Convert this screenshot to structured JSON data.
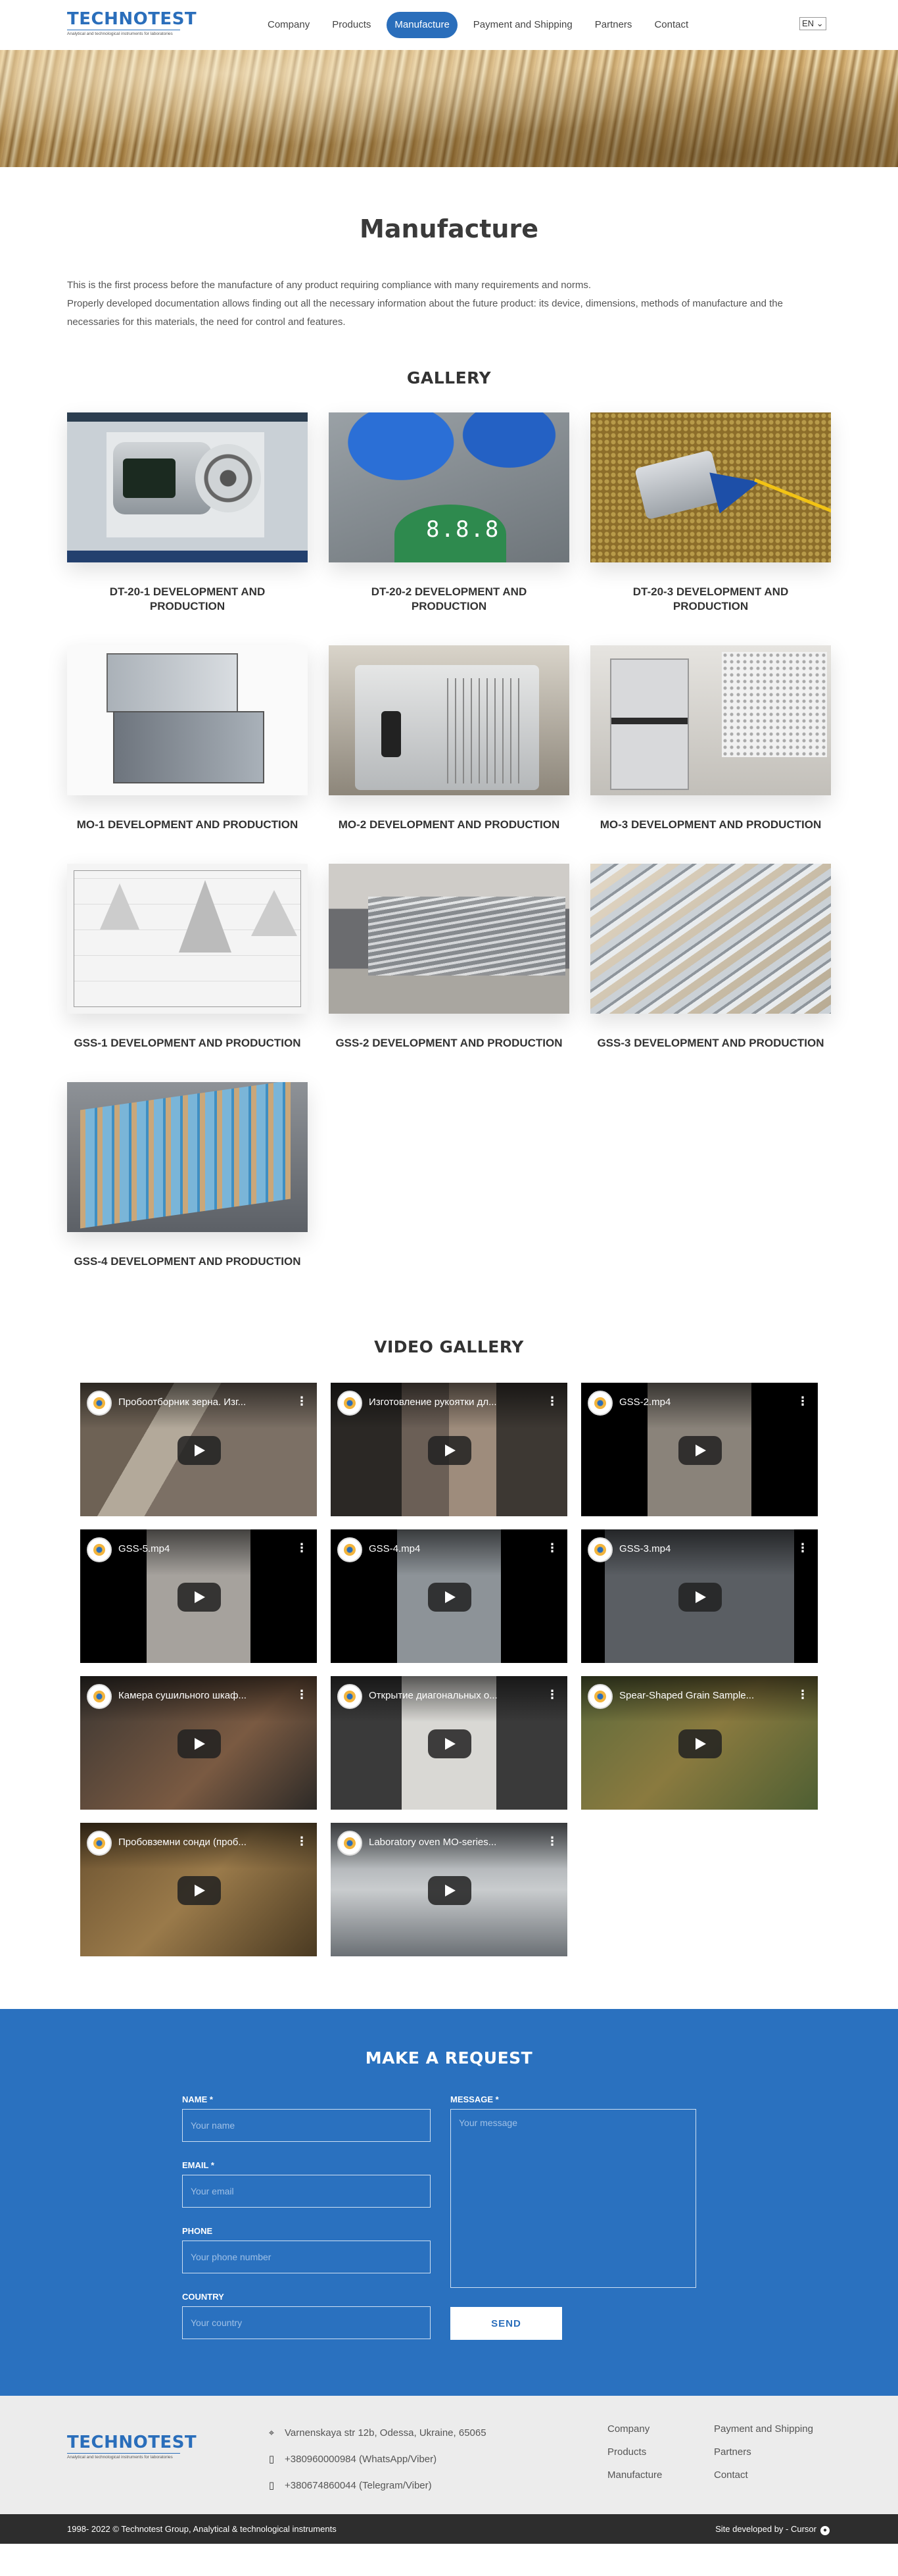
{
  "header": {
    "logo_main": "TECHNOTEST",
    "logo_sub": "Analytical and technological instruments for laboratories",
    "nav": [
      {
        "label": "Company"
      },
      {
        "label": "Products"
      },
      {
        "label": "Manufacture",
        "active": true
      },
      {
        "label": "Payment and Shipping"
      },
      {
        "label": "Partners"
      },
      {
        "label": "Contact"
      }
    ],
    "lang": "EN"
  },
  "main": {
    "title": "Manufacture",
    "intro_line1": "This is the first process before the manufacture of any product requiring compliance with many requirements and norms.",
    "intro_line2": "Properly developed documentation allows finding out all the necessary information about the future product: its device, dimensions, methods of manufacture and the necessaries for this materials, the need for control and features."
  },
  "gallery": {
    "title": "GALLERY",
    "items": [
      {
        "caption": "DT-20-1 DEVELOPMENT AND PRODUCTION",
        "image": "img-dt1"
      },
      {
        "caption": "DT-20-2 DEVELOPMENT AND PRODUCTION",
        "image": "img-dt2"
      },
      {
        "caption": "DT-20-3 DEVELOPMENT AND PRODUCTION",
        "image": "img-dt3"
      },
      {
        "caption": "MO-1 DEVELOPMENT AND PRODUCTION",
        "image": "img-mo1"
      },
      {
        "caption": "MO-2 DEVELOPMENT AND PRODUCTION",
        "image": "img-mo2"
      },
      {
        "caption": "MO-3 DEVELOPMENT AND PRODUCTION",
        "image": "img-mo3"
      },
      {
        "caption": "GSS-1 DEVELOPMENT AND PRODUCTION",
        "image": "img-gss1"
      },
      {
        "caption": "GSS-2 DEVELOPMENT AND PRODUCTION",
        "image": "img-gss2"
      },
      {
        "caption": "GSS-3 DEVELOPMENT AND PRODUCTION",
        "image": "img-gss3"
      },
      {
        "caption": "GSS-4 DEVELOPMENT AND PRODUCTION",
        "image": "img-gss4"
      }
    ]
  },
  "video_gallery": {
    "title": "VIDEO GALLERY",
    "videos": [
      {
        "title": "Пробоотборник зерна. Изг...",
        "thumb": "t1"
      },
      {
        "title": "Изготовление рукоятки дл...",
        "thumb": "t2"
      },
      {
        "title": "GSS-2.mp4",
        "thumb": "t3"
      },
      {
        "title": "GSS-5.mp4",
        "thumb": "t4"
      },
      {
        "title": "GSS-4.mp4",
        "thumb": "t5"
      },
      {
        "title": "GSS-3.mp4",
        "thumb": "t6"
      },
      {
        "title": "Камера сушильного шкаф...",
        "thumb": "t7"
      },
      {
        "title": "Открытие диагональных о...",
        "thumb": "t8"
      },
      {
        "title": "Spear-Shaped Grain Sample...",
        "thumb": "t9"
      },
      {
        "title": "Пробовземни сонди (проб...",
        "thumb": "t10"
      },
      {
        "title": "Laboratory oven MO-series...",
        "thumb": "t11"
      }
    ]
  },
  "request": {
    "title": "MAKE A REQUEST",
    "name_label": "NAME *",
    "name_placeholder": "Your name",
    "email_label": "EMAIL *",
    "email_placeholder": "Your email",
    "phone_label": "PHONE",
    "phone_placeholder": "Your phone number",
    "country_label": "COUNTRY",
    "country_placeholder": "Your country",
    "message_label": "MESSAGE *",
    "message_placeholder": "Your message",
    "send_label": "SEND"
  },
  "footer": {
    "address": "Varnenskaya str 12b, Odessa, Ukraine, 65065",
    "phone1": "+380960000984 (WhatsApp/Viber)",
    "phone2": "+380674860044 (Telegram/Viber)",
    "links": [
      "Company",
      "Payment and Shipping",
      "Products",
      "Partners",
      "Manufacture",
      "Contact"
    ],
    "copyright": "1998- 2022 © Technotest Group, Analytical & technological instruments",
    "developed_by": "Site developed by - Cursor"
  },
  "colors": {
    "brand": "#2a6ebb",
    "request_bg": "#2a71bf",
    "footer_bg": "#ececec",
    "bottom_bar": "#2d2d2d"
  }
}
